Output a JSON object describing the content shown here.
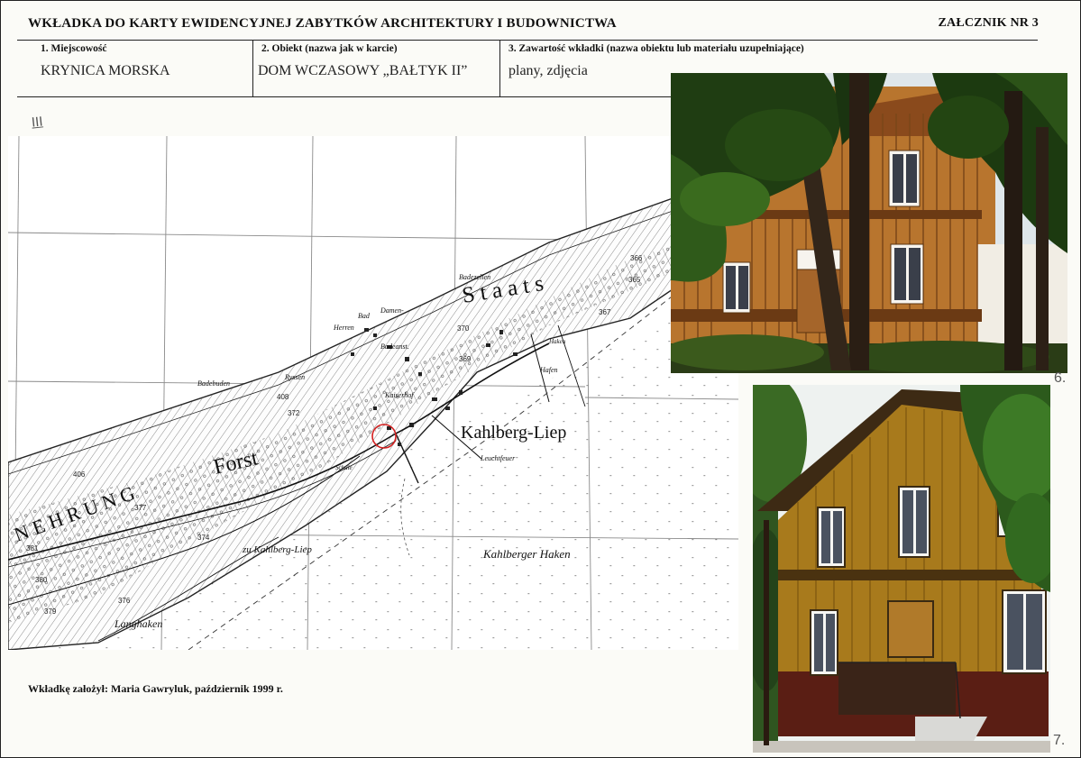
{
  "header": {
    "title": "WKŁADKA DO KARTY EWIDENCYJNEJ ZABYTKÓW ARCHITEKTURY I BUDOWNICTWA",
    "annex": "ZAŁCZNIK NR 3"
  },
  "fields": [
    {
      "label": "1. Miejscowość",
      "value": "KRYNICA MORSKA"
    },
    {
      "label": "2. Obiekt (nazwa jak w karcie)",
      "value": "DOM WCZASOWY „BAŁTYK II”"
    },
    {
      "label": "3. Zawartość wkładki (nazwa obiektu lub materiału uzupełniające)",
      "value": "plany, zdjęcia"
    }
  ],
  "handwritten": {
    "map_mark": "III",
    "photo1_number": "6.",
    "photo2_number": "7."
  },
  "map": {
    "labels": {
      "staats": "S t a a t s",
      "kahlberg_liep": "Kahlberg-Liep",
      "forst": "Forst",
      "nehrung": "N E H R U N G",
      "kahlberger_haken": "Kahlberger Haken",
      "zu_kahlberg_liep": "zu Kahlberg-Liep",
      "langhaken": "Langhaken",
      "leuchtfeuer": "Leuchtfeuer",
      "hafen": "Hafen",
      "badebuden": "Badebuden",
      "badezellen": "Badezellen",
      "damen": "Damen-",
      "bad": "Bad",
      "herren": "Herren",
      "badeanst": "Badeanst.",
      "kaiserhof": "Kaiserhof",
      "schule": "Schule",
      "ryssen": "Ryssen",
      "haken": "Haken"
    },
    "elevations": [
      "366",
      "365",
      "367",
      "370",
      "369",
      "372",
      "377",
      "374",
      "381",
      "380",
      "376",
      "379",
      "406",
      "408"
    ]
  },
  "footer": {
    "author": "Wkładkę założył: Maria Gawryluk, październik 1999 r."
  },
  "colors": {
    "wood_orange": "#b8752e",
    "wood_ochre": "#a87a1c",
    "foliage": "#1f3d12",
    "marker_red": "#d42020",
    "paper": "#fbfbf7"
  }
}
